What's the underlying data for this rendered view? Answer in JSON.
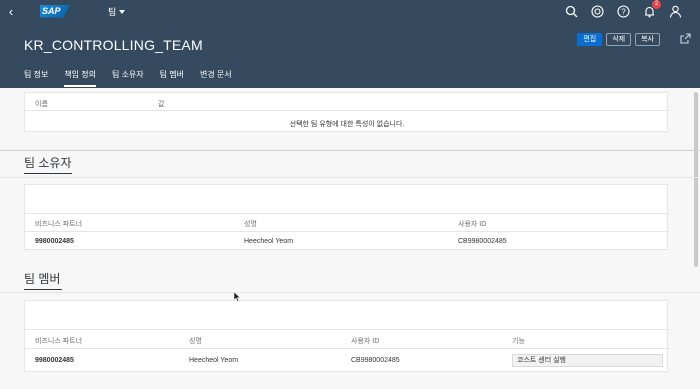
{
  "shell": {
    "app_title": "팀",
    "icons": [
      "search-icon",
      "copilot-icon",
      "help-icon",
      "notifications-icon",
      "user-icon"
    ],
    "notification_count": "2"
  },
  "header": {
    "title": "KR_CONTROLLING_TEAM",
    "actions": {
      "edit": "편집",
      "delete": "삭제",
      "copy": "복사"
    },
    "tabs": [
      "팀 정보",
      "책임 정의",
      "팀 소유자",
      "팀 멤버",
      "변경 문서"
    ],
    "active_tab": 1
  },
  "responsibility": {
    "col_name": "이름",
    "col_value": "값",
    "empty_text": "선택한 팀 유형에 대한 특성이 없습니다."
  },
  "owners": {
    "title": "팀 소유자",
    "headers": [
      "비즈니스 파트너",
      "성명",
      "사용자 ID"
    ],
    "row": {
      "bp": "9980002485",
      "name": "Heecheol Yeom",
      "user_id": "CB9980002485"
    }
  },
  "members": {
    "title": "팀 멤버",
    "headers": [
      "비즈니스 파트너",
      "성명",
      "사용자 ID",
      "기능"
    ],
    "row": {
      "bp": "9980002485",
      "name": "Heecheol Yeom",
      "user_id": "CB9980002485",
      "function": "코스트 센터 실행"
    }
  },
  "colors": {
    "shell": "#354a5f",
    "primary": "#0a6ed1",
    "badge": "#e9444b"
  }
}
